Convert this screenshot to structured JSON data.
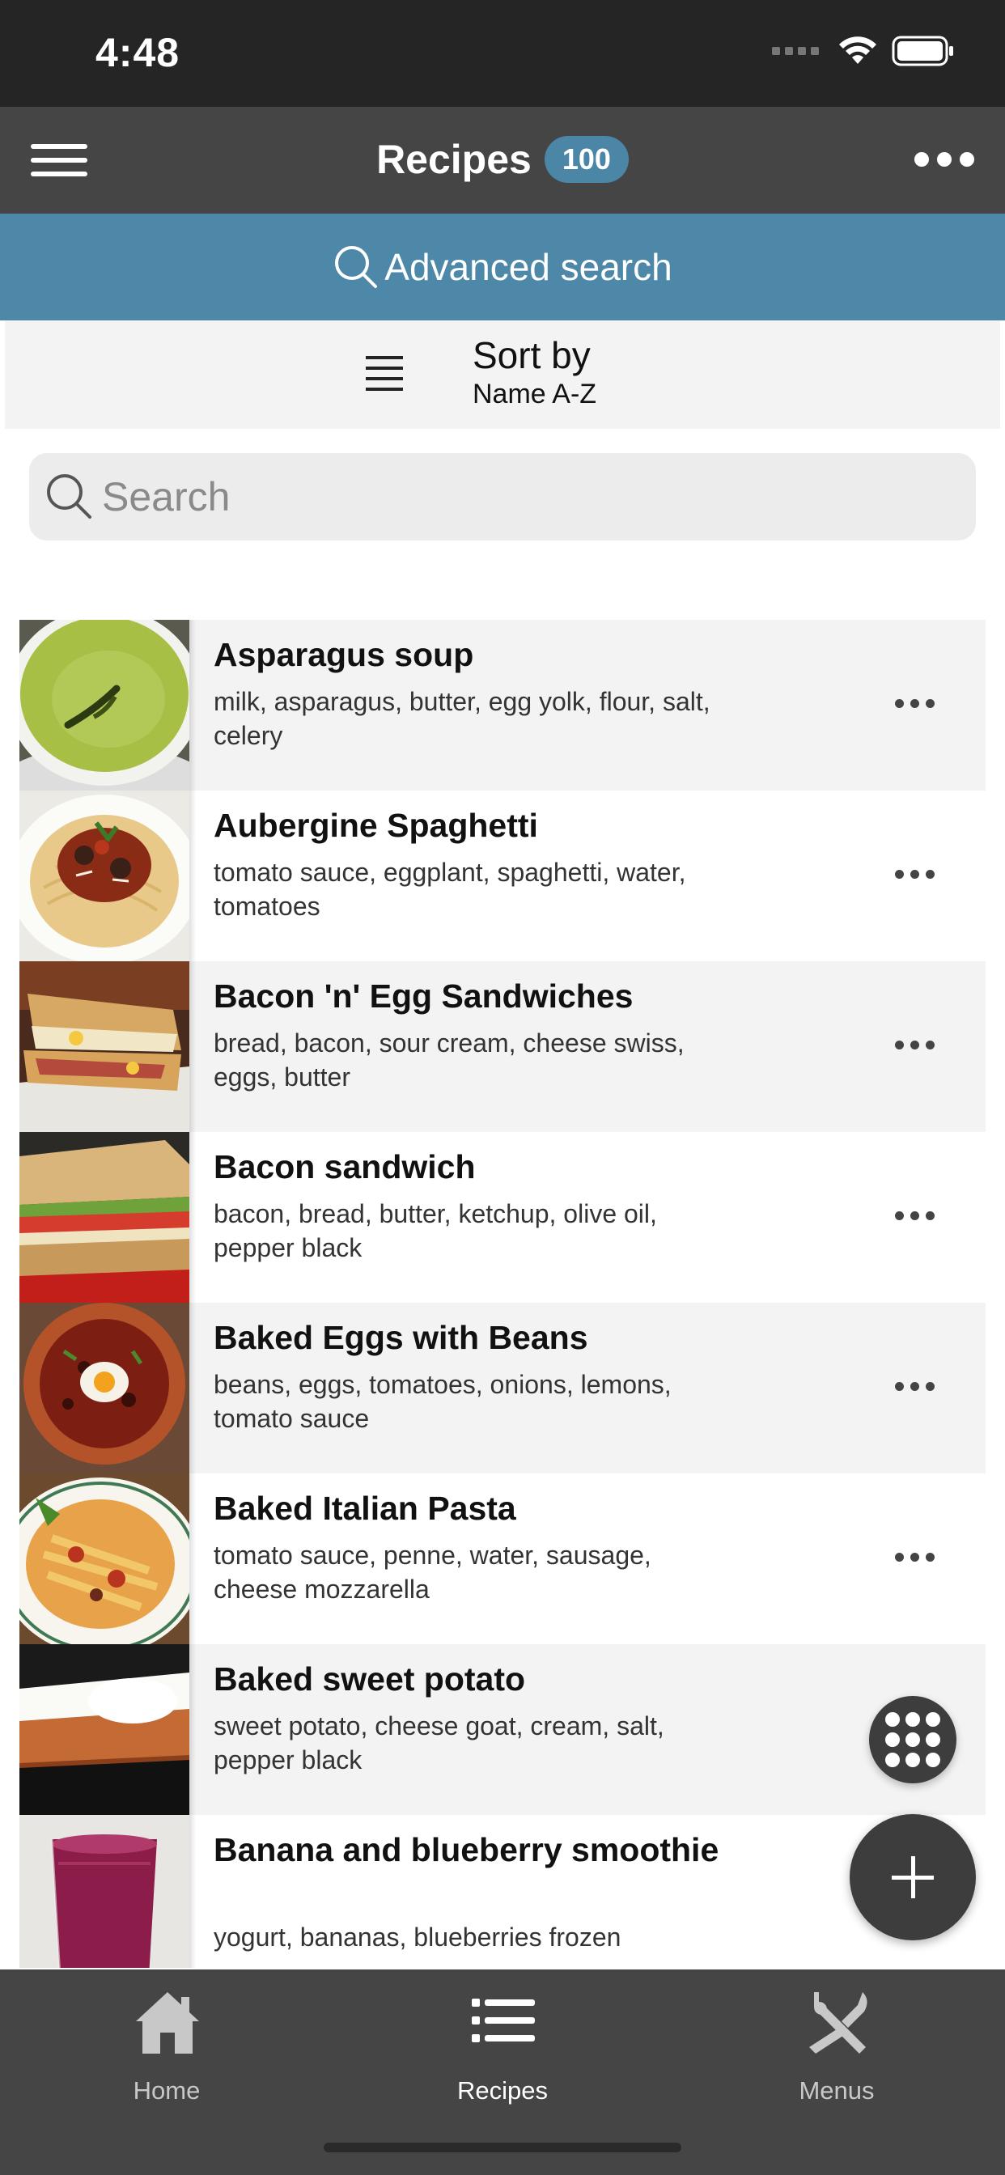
{
  "status_bar": {
    "time": "4:48"
  },
  "header": {
    "title": "Recipes",
    "count": "100"
  },
  "advanced_search": {
    "label": "Advanced search"
  },
  "sort": {
    "label": "Sort by",
    "value": "Name A-Z"
  },
  "search": {
    "placeholder": "Search"
  },
  "recipes": [
    {
      "name": "Asparagus soup",
      "ingredients": "milk, asparagus, butter, egg yolk, flour, salt, celery"
    },
    {
      "name": "Aubergine Spaghetti",
      "ingredients": "tomato sauce, eggplant, spaghetti, water, tomatoes"
    },
    {
      "name": "Bacon 'n' Egg Sandwiches",
      "ingredients": "bread, bacon, sour cream, cheese swiss, eggs, butter"
    },
    {
      "name": "Bacon sandwich",
      "ingredients": "bacon, bread, butter, ketchup, olive oil, pepper black"
    },
    {
      "name": "Baked Eggs with Beans",
      "ingredients": "beans, eggs, tomatoes, onions, lemons, tomato sauce"
    },
    {
      "name": "Baked Italian Pasta",
      "ingredients": "tomato sauce, penne, water, sausage, cheese mozzarella"
    },
    {
      "name": "Baked sweet potato",
      "ingredients": "sweet potato, cheese goat, cream, salt, pepper black"
    },
    {
      "name": "Banana and blueberry smoothie",
      "ingredients": "yogurt, bananas, blueberries frozen"
    }
  ],
  "tabs": [
    {
      "label": "Home",
      "icon": "home-icon"
    },
    {
      "label": "Recipes",
      "icon": "list-icon",
      "active": true
    },
    {
      "label": "Menus",
      "icon": "utensils-icon"
    }
  ],
  "colors": {
    "header_bg": "#454545",
    "accent_blue": "#4d88a8",
    "badge_bg": "#4b86a6",
    "tab_bar_bg": "#454545",
    "fab_bg": "#3d3d3d"
  }
}
